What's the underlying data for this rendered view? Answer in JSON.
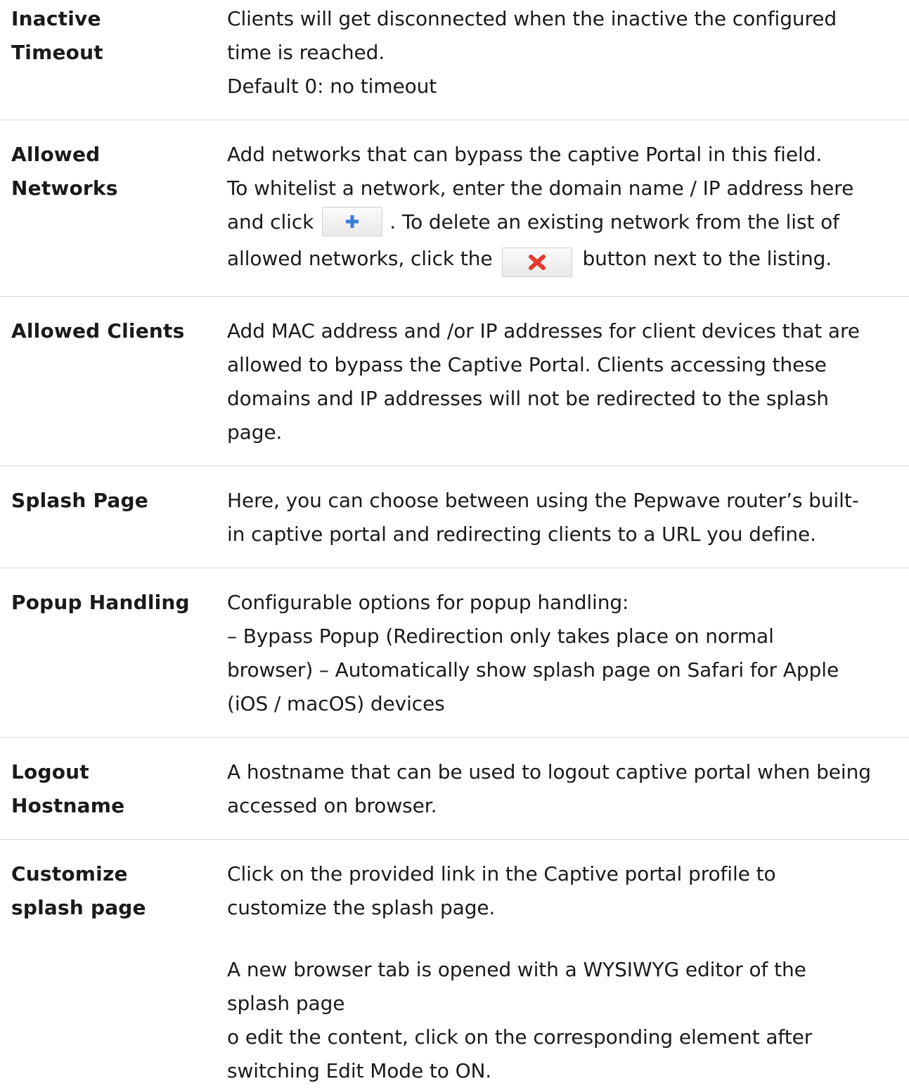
{
  "rows": [
    {
      "label": [
        "Inactive",
        "Timeout"
      ],
      "lines": [
        "Clients will get disconnected when the inactive the configured",
        "time is reached.",
        "Default 0: no timeout"
      ]
    },
    {
      "label": [
        "Allowed",
        "Networks"
      ],
      "lines": [
        "Add networks that can bypass the captive Portal in this field.",
        "To whitelist a network, enter the domain name / IP address here"
      ],
      "line3_before": "and click",
      "line3_after": ". To delete an existing network from the list of",
      "line4_before": "allowed networks, click the",
      "line4_after": "button next to the listing.",
      "add_icon": "plus-icon",
      "delete_icon": "red-x-icon",
      "add_icon_color": "#3b7dd8",
      "delete_icon_color": "#e53b2c"
    },
    {
      "label": [
        "Allowed Clients"
      ],
      "lines": [
        "Add MAC address and /or IP addresses for client devices that are",
        "allowed to bypass the Captive Portal. Clients accessing these",
        "domains and IP addresses will not be redirected to the splash",
        "page."
      ]
    },
    {
      "label": [
        "Splash Page"
      ],
      "lines": [
        "Here, you can choose between using the Pepwave router’s built-",
        "in captive portal and redirecting clients to a URL you define."
      ]
    },
    {
      "label": [
        "Popup Handling"
      ],
      "lines": [
        "Configurable options for popup handling:",
        "– Bypass Popup (Redirection only takes place on normal",
        "browser) –  Automatically show splash page on Safari for Apple",
        "(iOS / macOS) devices"
      ]
    },
    {
      "label": [
        "Logout",
        "Hostname"
      ],
      "lines": [
        "A hostname that can be used to logout captive portal when being",
        "accessed on browser."
      ]
    },
    {
      "label": [
        "Customize",
        "splash page"
      ],
      "lines": [
        "Click on the provided link in the Captive portal profile to",
        "customize the splash page."
      ],
      "lines2": [
        "A new browser tab is opened with a WYSIWYG editor of the",
        "splash page",
        "o edit the content, click on the corresponding element after",
        "switching Edit Mode to ON."
      ]
    }
  ]
}
